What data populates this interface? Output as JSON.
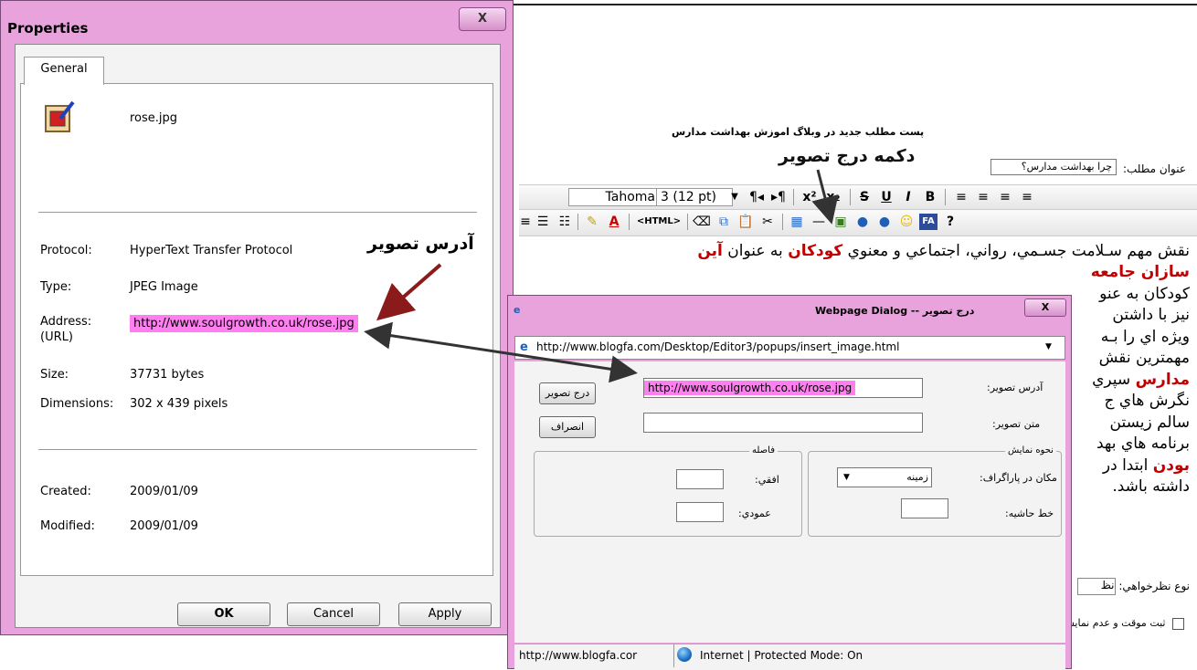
{
  "editor": {
    "heading": "پست مطلب جدید در وبلاگ اموزش بهداشت مدارس",
    "title_label": "عنوان مطلب:",
    "title_value": "چرا بهداشت مدارس؟",
    "insert_image_annotation": "دکمه درج تصویر",
    "font_name": "Tahoma",
    "font_size": "3 (12 pt)",
    "html_button": "<HTML>",
    "help_button": "?",
    "content_lines": [
      {
        "parts": [
          "نقش مهم سـلامت جسـمي، رواني، اجتماعي و معنوي ",
          "کودکان",
          " به عنوان ",
          "آين"
        ]
      },
      {
        "parts": [
          "سازان جامعه"
        ]
      },
      {
        "parts": [
          "کودکان به عنو"
        ]
      },
      {
        "parts": [
          "نيز با داشتن "
        ]
      },
      {
        "parts": [
          "ويژه اي را بـه"
        ]
      },
      {
        "parts": [
          "مهمترين نقش"
        ]
      },
      {
        "parts": [
          "مدارس",
          " سپري"
        ]
      },
      {
        "parts": [
          "نگرش هاي ج"
        ]
      },
      {
        "parts": [
          "سالم زيستن"
        ]
      },
      {
        "parts": [
          "برنامه هاي بهد"
        ]
      },
      {
        "parts": [
          "بودن",
          " ابتدا در"
        ]
      },
      {
        "parts": [
          "داشته باشد."
        ]
      }
    ],
    "comment_label": "نوع نظرخواهي:",
    "comment_value": "نظ",
    "save_label": "ثبت موقت و عدم نمايش در وبلاگ"
  },
  "properties": {
    "title": "Properties",
    "close_glyph": "X",
    "tab": "General",
    "file_name": "rose.jpg",
    "address_annotation": "آدرس تصویر",
    "fields": [
      {
        "label": "Protocol:",
        "value": "HyperText Transfer Protocol"
      },
      {
        "label": "Type:",
        "value": "JPEG Image"
      },
      {
        "label": "Address:\n(URL)",
        "value": "http://www.soulgrowth.co.uk/rose.jpg"
      },
      {
        "label": "Size:",
        "value": "37731 bytes"
      },
      {
        "label": "Dimensions:",
        "value": "302 x 439 pixels"
      },
      {
        "label": "Created:",
        "value": "2009/01/09"
      },
      {
        "label": "Modified:",
        "value": "2009/01/09"
      }
    ],
    "address_label_1": "Address:",
    "address_label_2": "(URL)",
    "buttons": {
      "ok": "OK",
      "cancel": "Cancel",
      "apply": "Apply"
    }
  },
  "dialog": {
    "title": "درج تصوير -- Webpage Dialog",
    "close_glyph": "X",
    "url": "http://www.blogfa.com/Desktop/Editor3/popups/insert_image.html",
    "image_address_label": "آدرس تصوير:",
    "image_address_value": "http://www.soulgrowth.co.uk/rose.jpg",
    "alt_text_label": "متن تصوير:",
    "alt_text_value": "",
    "insert_button": "درج تصوير",
    "cancel_button": "انصراف",
    "display_group": "نحوه نمايش",
    "paragraph_position_label": "مکان در پاراگراف:",
    "paragraph_position_value": "زمينه",
    "border_label": "خط حاشيه:",
    "spacing_group": "فاصله",
    "horizontal_label": "افقي:",
    "vertical_label": "عمودي:",
    "status_url": "http://www.blogfa.cor",
    "status_zone": "Internet | Protected Mode: On"
  },
  "colors": {
    "window_frame": "#e8a3dd",
    "highlight": "#ff7ef0",
    "annotation_arrow": "#8b1a1a",
    "link_arrow": "#333333"
  }
}
